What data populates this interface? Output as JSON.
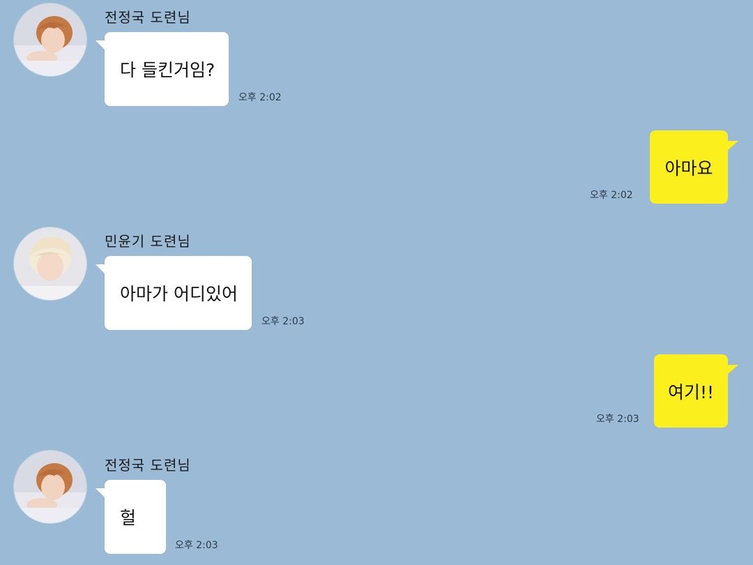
{
  "messages": [
    {
      "sender": "전정국 도련님",
      "text": "다 들킨거임?",
      "time": "오후 2:02",
      "direction": "incoming",
      "avatar": "person-avatar-orange-hair"
    },
    {
      "text": "아마요",
      "time": "오후 2:02",
      "direction": "outgoing"
    },
    {
      "sender": "민윤기 도련님",
      "text": "아마가 어디있어",
      "time": "오후 2:03",
      "direction": "incoming",
      "avatar": "person-avatar-blond-hair"
    },
    {
      "text": "여기!!",
      "time": "오후 2:03",
      "direction": "outgoing"
    },
    {
      "sender": "전정국 도련님",
      "text": "헐",
      "time": "오후 2:03",
      "direction": "incoming",
      "avatar": "person-avatar-orange-hair"
    }
  ],
  "colors": {
    "background": "#9bbad5",
    "incoming_bubble": "#ffffff",
    "outgoing_bubble": "#fcef1e"
  }
}
